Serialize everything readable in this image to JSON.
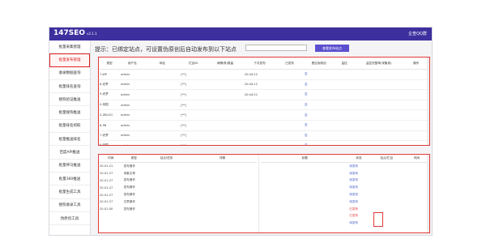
{
  "header": {
    "logo": "147SEO",
    "version": "v2.1.1",
    "user": "企查QQ群"
  },
  "sidebar": [
    {
      "label": "批量采集管理",
      "active": false
    },
    {
      "label": "批量发布管理",
      "active": true
    },
    {
      "label": "收录数据查询",
      "active": false
    },
    {
      "label": "批量排名查询",
      "active": false
    },
    {
      "label": "搜狗验证推送",
      "active": false
    },
    {
      "label": "批量搜狗推送",
      "active": false
    },
    {
      "label": "批量排名抓取",
      "active": false
    },
    {
      "label": "批量推送排名",
      "active": false
    },
    {
      "label": "百度API推送",
      "active": false
    },
    {
      "label": "批量神马推送",
      "active": false
    },
    {
      "label": "批量360推送",
      "active": false
    },
    {
      "label": "批量生成工具",
      "active": false
    },
    {
      "label": "搜狗收录工具",
      "active": false
    },
    {
      "label": "伪原创工具",
      "active": false
    }
  ],
  "hint": "提示：已绑定站点，可设置伪原创后自动发布到以下站点",
  "hint_input_placeholder": "",
  "hint_button": "查看发布站点",
  "sites_table": {
    "headers": [
      "类型",
      "用户名",
      "网址",
      "栏目ID",
      "间隔/条/数量",
      "下次发布",
      "已发布",
      "是否伪原创",
      "监控",
      "监控完整率(采集到)",
      "操作"
    ],
    "rows": [
      [
        "7-WP",
        "admin",
        "",
        "[**]",
        "",
        "20:44:12",
        "",
        "否",
        "",
        "",
        ""
      ],
      [
        "8-织梦",
        "admin",
        "",
        "[**]",
        "",
        "20:44:12",
        "",
        "否",
        "",
        "",
        ""
      ],
      [
        "9-织梦",
        "admin",
        "",
        "[**]",
        "",
        "20:44:21",
        "",
        "否",
        "",
        "",
        ""
      ],
      [
        "4-帝国",
        "admin",
        "",
        "[**]",
        "",
        "",
        "",
        "否",
        "",
        "",
        ""
      ],
      [
        "5-ZBLOG",
        "admin",
        "",
        "[**]",
        "",
        "",
        "",
        "否",
        "",
        "",
        ""
      ],
      [
        "6-PB",
        "admin",
        "",
        "[**]",
        "",
        "",
        "",
        "否",
        "",
        "",
        ""
      ],
      [
        "7-织梦",
        "admin",
        "",
        "[**]",
        "",
        "",
        "",
        "否",
        "",
        "",
        ""
      ],
      [
        "8-帝国",
        "admin",
        "",
        "[**]",
        "",
        "",
        "",
        "否",
        "",
        "",
        ""
      ]
    ]
  },
  "log_table": {
    "headers": [
      "时间",
      "类型",
      "站点/任务",
      "详情"
    ],
    "rows": [
      [
        "20-01-21",
        "发布操作",
        "",
        ""
      ],
      [
        "20-01-27",
        "采集文章",
        "",
        ""
      ],
      [
        "20-01-27",
        "发布操作",
        "",
        ""
      ],
      [
        "20-01-27",
        "发布操作",
        "",
        ""
      ],
      [
        "20-01-27",
        "发布操作",
        "",
        ""
      ],
      [
        "20-01-27",
        "文章操作",
        "",
        ""
      ],
      [
        "20-01-00",
        "发布操作",
        "",
        ""
      ]
    ]
  },
  "publish_table": {
    "headers": [
      "标题",
      "状态",
      "站点/栏目",
      "时间"
    ],
    "rows": [
      [
        "",
        "待发布",
        "",
        ""
      ],
      [
        "",
        "待发布",
        "",
        ""
      ],
      [
        "",
        "待发布",
        "",
        ""
      ],
      [
        "",
        "待发布",
        "",
        ""
      ],
      [
        "",
        "待发布",
        "",
        ""
      ],
      [
        "",
        "待发布",
        "",
        ""
      ],
      [
        "",
        "已发布",
        "",
        ""
      ],
      [
        "",
        "已发布",
        "",
        ""
      ],
      [
        "",
        "待发布",
        "",
        ""
      ]
    ]
  },
  "colors": {
    "topbar": "#3e2f9e",
    "highlight": "#e03a3a",
    "button": "#5b4fcf"
  }
}
